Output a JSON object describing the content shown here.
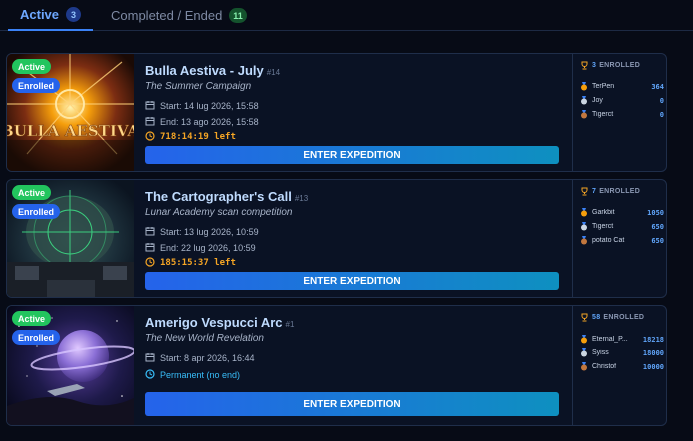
{
  "tabs": [
    {
      "label": "Active",
      "count": "3"
    },
    {
      "label": "Completed / Ended",
      "count": "11"
    }
  ],
  "status_labels": {
    "active": "Active",
    "enrolled": "Enrolled"
  },
  "button_label": "ENTER EXPEDITION",
  "enrolled_suffix": "ENROLLED",
  "cards": [
    {
      "title": "Bulla Aestiva - July",
      "number": "#14",
      "subtitle": "The Summer Campaign",
      "thumb_text": "BULLA AESTIVA",
      "start": "Start: 14 lug 2026, 15:58",
      "end": "End: 13 ago 2026, 15:58",
      "timer": "718:14:19 left",
      "enrolled_count": "3",
      "leaderboard": [
        {
          "name": "TerPen",
          "points": "364"
        },
        {
          "name": "Joy",
          "points": "0"
        },
        {
          "name": "Tigerct",
          "points": "0"
        }
      ]
    },
    {
      "title": "The Cartographer's Call",
      "number": "#13",
      "subtitle": "Lunar Academy scan competition",
      "start": "Start: 13 lug 2026, 10:59",
      "end": "End: 22 lug 2026, 10:59",
      "timer": "185:15:37 left",
      "enrolled_count": "7",
      "leaderboard": [
        {
          "name": "Garkbit",
          "points": "1050"
        },
        {
          "name": "Tigerct",
          "points": "650"
        },
        {
          "name": "potato Cat",
          "points": "650"
        }
      ]
    },
    {
      "title": "Amerigo Vespucci Arc",
      "number": "#1",
      "subtitle": "The New World Revelation",
      "start": "Start: 8 apr 2026, 16:44",
      "permanent": "Permanent (no end)",
      "enrolled_count": "58",
      "leaderboard": [
        {
          "name": "Eternal_P...",
          "points": "18218"
        },
        {
          "name": "Syiss",
          "points": "18000"
        },
        {
          "name": "Christof",
          "points": "10000"
        }
      ]
    }
  ],
  "colors": {
    "accent": "#3b82f6",
    "active_pill": "#22c55e",
    "enrolled_pill": "#2563eb",
    "timer": "#f5a524",
    "permanent": "#38bdf8"
  }
}
